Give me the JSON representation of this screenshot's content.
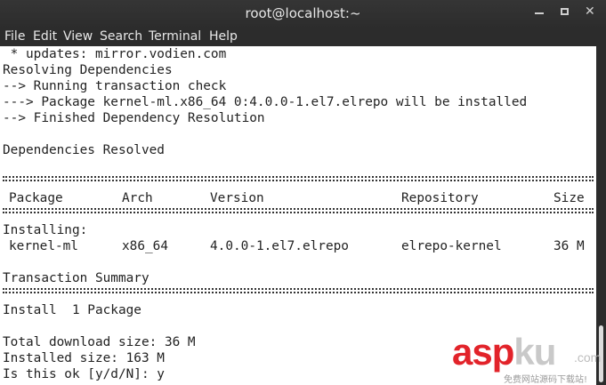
{
  "window": {
    "title": "root@localhost:~",
    "controls": {
      "minimize": "minimize-icon",
      "maximize": "maximize-icon",
      "close": "✕"
    }
  },
  "menu": [
    "File",
    "Edit",
    "View",
    "Search",
    "Terminal",
    "Help"
  ],
  "output": {
    "lines_top": [
      " * updates: mirror.vodien.com",
      "Resolving Dependencies",
      "--> Running transaction check",
      "---> Package kernel-ml.x86_64 0:4.0.0-1.el7.elrepo will be installed",
      "--> Finished Dependency Resolution",
      "",
      "Dependencies Resolved"
    ],
    "table": {
      "headers": [
        "Package",
        "Arch",
        "Version",
        "Repository",
        "Size"
      ],
      "section": "Installing:",
      "rows": [
        [
          "kernel-ml",
          "x86_64",
          "4.0.0-1.el7.elrepo",
          "elrepo-kernel",
          "36 M"
        ]
      ]
    },
    "summary_title": "Transaction Summary",
    "summary_install": "Install  1 Package",
    "total_download": "Total download size: 36 M",
    "installed_size": "Installed size: 163 M",
    "prompt": "Is this ok [y/d/N]: y"
  },
  "watermark": {
    "logo_red": "asp",
    "logo_grey": "ku",
    "dotcom": ".com",
    "subtitle": "免费网站源码下载站!"
  }
}
